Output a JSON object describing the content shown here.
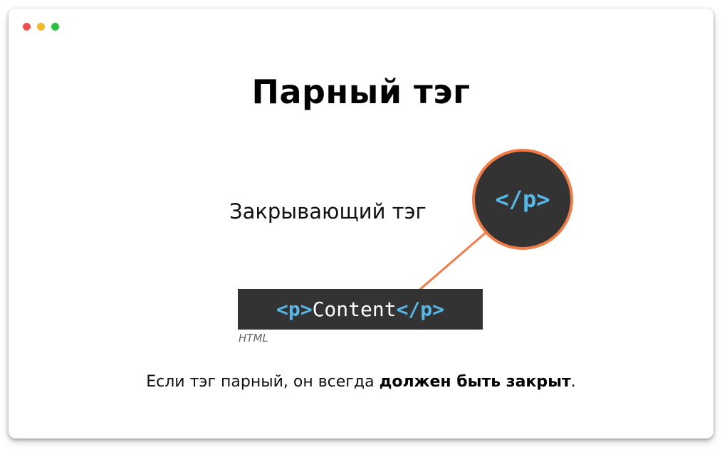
{
  "window": {
    "controls": [
      {
        "name": "close",
        "color": "#f0524f"
      },
      {
        "name": "minimize",
        "color": "#f3b72a"
      },
      {
        "name": "maximize",
        "color": "#2bc140"
      }
    ]
  },
  "title": "Парный тэг",
  "callout": {
    "label": "Закрывающий тэг",
    "tag": "</p>"
  },
  "code": {
    "open_tag": "<p>",
    "content": "Content",
    "close_tag": "</p>",
    "caption": "HTML"
  },
  "footer": {
    "text_before": "Если тэг парный, он всегда ",
    "bold": "должен быть закрыт",
    "text_after": "."
  },
  "colors": {
    "accent": "#f27a45",
    "tag": "#56b8e8",
    "code_bg": "#333333"
  }
}
